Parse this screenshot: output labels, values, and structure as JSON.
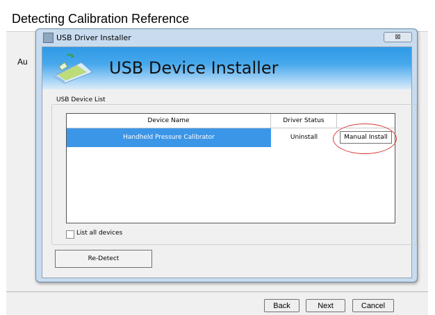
{
  "outer_window": {
    "title": "Detecting Calibration Reference",
    "partial_text": "Au",
    "buttons": {
      "back": "Back",
      "next": "Next",
      "cancel": "Cancel"
    }
  },
  "dialog": {
    "title": "USB Driver Installer",
    "close_glyph": "⊠",
    "banner_title": "USB Device Installer",
    "group_label": "USB Device List",
    "table": {
      "columns": [
        "Device Name",
        "Driver Status",
        ""
      ],
      "rows": [
        {
          "device_name": "Handheld Pressure Calibrator",
          "driver_status": "Uninstall",
          "action": "Manual Install"
        }
      ]
    },
    "list_all_devices": {
      "label": "List all devices",
      "checked": false
    },
    "redetect_label": "Re-Detect"
  },
  "colors": {
    "selection": "#3c96e8",
    "banner": "#2f9ae6",
    "annotation": "#d83a3a"
  },
  "icons": [
    "usb-installer-window-icon",
    "close-icon",
    "usb-drive-logo"
  ]
}
